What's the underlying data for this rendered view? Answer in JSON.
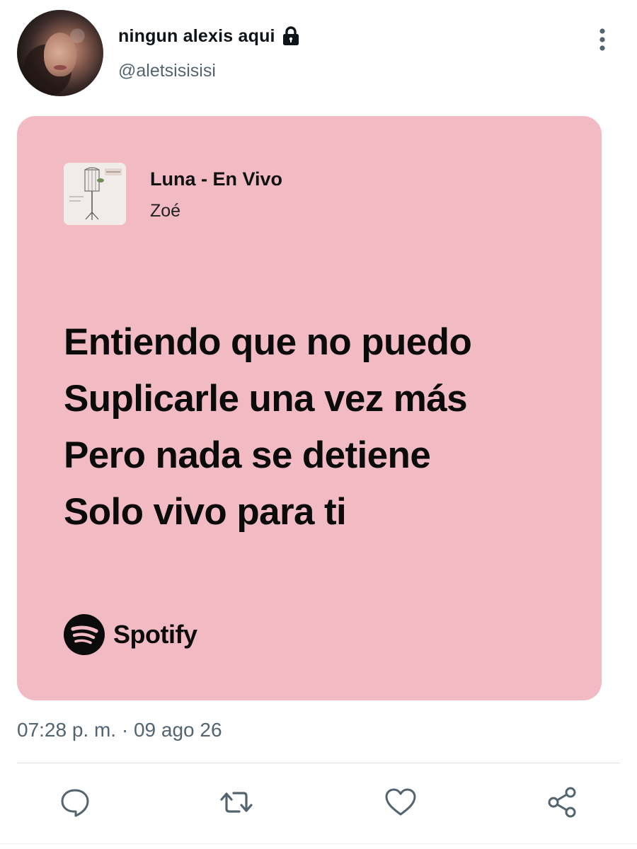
{
  "author": {
    "display_name": "ningun alexis aqui",
    "handle": "@aletsisisisi",
    "protected_icon": "lock-icon",
    "avatar_icon": "avatar"
  },
  "menu": {
    "more_icon": "vertical-ellipsis-icon"
  },
  "spotify_card": {
    "background_color": "#f2bbc4",
    "song_title": "Luna - En Vivo",
    "artist": "Zoé",
    "lyrics": [
      "Entiendo que no puedo",
      "Suplicarle una vez más",
      "Pero nada se detiene",
      "Solo vivo para ti"
    ],
    "brand": "Spotify"
  },
  "timestamp": "07:28 p. m. · 09 ago 26",
  "actions": {
    "reply_icon": "reply-icon",
    "retweet_icon": "retweet-icon",
    "like_icon": "heart-icon",
    "share_icon": "share-icon",
    "icon_color": "#536471"
  }
}
